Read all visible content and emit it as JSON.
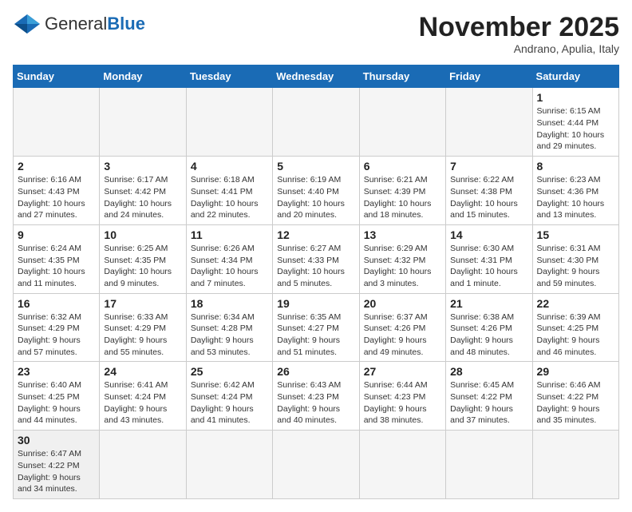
{
  "logo": {
    "text_normal": "General",
    "text_blue": "Blue"
  },
  "header": {
    "month": "November 2025",
    "location": "Andrano, Apulia, Italy"
  },
  "weekdays": [
    "Sunday",
    "Monday",
    "Tuesday",
    "Wednesday",
    "Thursday",
    "Friday",
    "Saturday"
  ],
  "weeks": [
    [
      {
        "day": "",
        "info": ""
      },
      {
        "day": "",
        "info": ""
      },
      {
        "day": "",
        "info": ""
      },
      {
        "day": "",
        "info": ""
      },
      {
        "day": "",
        "info": ""
      },
      {
        "day": "",
        "info": ""
      },
      {
        "day": "1",
        "info": "Sunrise: 6:15 AM\nSunset: 4:44 PM\nDaylight: 10 hours and 29 minutes."
      }
    ],
    [
      {
        "day": "2",
        "info": "Sunrise: 6:16 AM\nSunset: 4:43 PM\nDaylight: 10 hours and 27 minutes."
      },
      {
        "day": "3",
        "info": "Sunrise: 6:17 AM\nSunset: 4:42 PM\nDaylight: 10 hours and 24 minutes."
      },
      {
        "day": "4",
        "info": "Sunrise: 6:18 AM\nSunset: 4:41 PM\nDaylight: 10 hours and 22 minutes."
      },
      {
        "day": "5",
        "info": "Sunrise: 6:19 AM\nSunset: 4:40 PM\nDaylight: 10 hours and 20 minutes."
      },
      {
        "day": "6",
        "info": "Sunrise: 6:21 AM\nSunset: 4:39 PM\nDaylight: 10 hours and 18 minutes."
      },
      {
        "day": "7",
        "info": "Sunrise: 6:22 AM\nSunset: 4:38 PM\nDaylight: 10 hours and 15 minutes."
      },
      {
        "day": "8",
        "info": "Sunrise: 6:23 AM\nSunset: 4:36 PM\nDaylight: 10 hours and 13 minutes."
      }
    ],
    [
      {
        "day": "9",
        "info": "Sunrise: 6:24 AM\nSunset: 4:35 PM\nDaylight: 10 hours and 11 minutes."
      },
      {
        "day": "10",
        "info": "Sunrise: 6:25 AM\nSunset: 4:35 PM\nDaylight: 10 hours and 9 minutes."
      },
      {
        "day": "11",
        "info": "Sunrise: 6:26 AM\nSunset: 4:34 PM\nDaylight: 10 hours and 7 minutes."
      },
      {
        "day": "12",
        "info": "Sunrise: 6:27 AM\nSunset: 4:33 PM\nDaylight: 10 hours and 5 minutes."
      },
      {
        "day": "13",
        "info": "Sunrise: 6:29 AM\nSunset: 4:32 PM\nDaylight: 10 hours and 3 minutes."
      },
      {
        "day": "14",
        "info": "Sunrise: 6:30 AM\nSunset: 4:31 PM\nDaylight: 10 hours and 1 minute."
      },
      {
        "day": "15",
        "info": "Sunrise: 6:31 AM\nSunset: 4:30 PM\nDaylight: 9 hours and 59 minutes."
      }
    ],
    [
      {
        "day": "16",
        "info": "Sunrise: 6:32 AM\nSunset: 4:29 PM\nDaylight: 9 hours and 57 minutes."
      },
      {
        "day": "17",
        "info": "Sunrise: 6:33 AM\nSunset: 4:29 PM\nDaylight: 9 hours and 55 minutes."
      },
      {
        "day": "18",
        "info": "Sunrise: 6:34 AM\nSunset: 4:28 PM\nDaylight: 9 hours and 53 minutes."
      },
      {
        "day": "19",
        "info": "Sunrise: 6:35 AM\nSunset: 4:27 PM\nDaylight: 9 hours and 51 minutes."
      },
      {
        "day": "20",
        "info": "Sunrise: 6:37 AM\nSunset: 4:26 PM\nDaylight: 9 hours and 49 minutes."
      },
      {
        "day": "21",
        "info": "Sunrise: 6:38 AM\nSunset: 4:26 PM\nDaylight: 9 hours and 48 minutes."
      },
      {
        "day": "22",
        "info": "Sunrise: 6:39 AM\nSunset: 4:25 PM\nDaylight: 9 hours and 46 minutes."
      }
    ],
    [
      {
        "day": "23",
        "info": "Sunrise: 6:40 AM\nSunset: 4:25 PM\nDaylight: 9 hours and 44 minutes."
      },
      {
        "day": "24",
        "info": "Sunrise: 6:41 AM\nSunset: 4:24 PM\nDaylight: 9 hours and 43 minutes."
      },
      {
        "day": "25",
        "info": "Sunrise: 6:42 AM\nSunset: 4:24 PM\nDaylight: 9 hours and 41 minutes."
      },
      {
        "day": "26",
        "info": "Sunrise: 6:43 AM\nSunset: 4:23 PM\nDaylight: 9 hours and 40 minutes."
      },
      {
        "day": "27",
        "info": "Sunrise: 6:44 AM\nSunset: 4:23 PM\nDaylight: 9 hours and 38 minutes."
      },
      {
        "day": "28",
        "info": "Sunrise: 6:45 AM\nSunset: 4:22 PM\nDaylight: 9 hours and 37 minutes."
      },
      {
        "day": "29",
        "info": "Sunrise: 6:46 AM\nSunset: 4:22 PM\nDaylight: 9 hours and 35 minutes."
      }
    ],
    [
      {
        "day": "30",
        "info": "Sunrise: 6:47 AM\nSunset: 4:22 PM\nDaylight: 9 hours and 34 minutes."
      },
      {
        "day": "",
        "info": ""
      },
      {
        "day": "",
        "info": ""
      },
      {
        "day": "",
        "info": ""
      },
      {
        "day": "",
        "info": ""
      },
      {
        "day": "",
        "info": ""
      },
      {
        "day": "",
        "info": ""
      }
    ]
  ]
}
